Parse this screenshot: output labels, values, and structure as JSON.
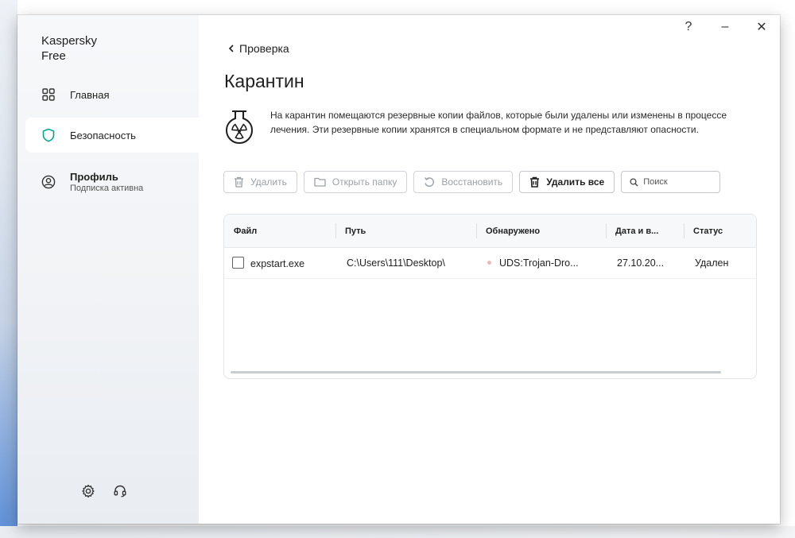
{
  "app": {
    "title": "Kaspersky\nFree"
  },
  "sidebar": {
    "items": [
      {
        "label": "Главная",
        "icon": "grid-icon"
      },
      {
        "label": "Безопасность",
        "icon": "shield-icon",
        "active": true
      },
      {
        "label": "Профиль",
        "sub": "Подписка активна",
        "icon": "profile-icon"
      }
    ],
    "bottom_icons": [
      "gear-icon",
      "headset-icon"
    ]
  },
  "titlebar": {
    "help": "?",
    "minimize": "–",
    "close": "✕"
  },
  "page": {
    "back_label": "Проверка",
    "title": "Карантин",
    "info": "На карантин помещаются резервные копии файлов, которые были удалены или изменены в процессе лечения. Эти резервные копии хранятся в специальном формате и не представляют опасности."
  },
  "toolbar": {
    "delete": "Удалить",
    "open_folder": "Открыть папку",
    "restore": "Восстановить",
    "delete_all": "Удалить все",
    "search_placeholder": "Поиск"
  },
  "table": {
    "headers": [
      "Файл",
      "Путь",
      "Обнаружено",
      "Дата и в...",
      "Статус"
    ],
    "rows": [
      {
        "file": "expstart.exe",
        "path": "C:\\Users\\111\\Desktop\\",
        "detected": "UDS:Trojan-Dro...",
        "date": "27.10.20...",
        "status": "Удален"
      }
    ]
  },
  "colors": {
    "accent": "#00a88e",
    "threat_dot": "#f2b8b8",
    "disabled_text": "#9aa0a6"
  }
}
